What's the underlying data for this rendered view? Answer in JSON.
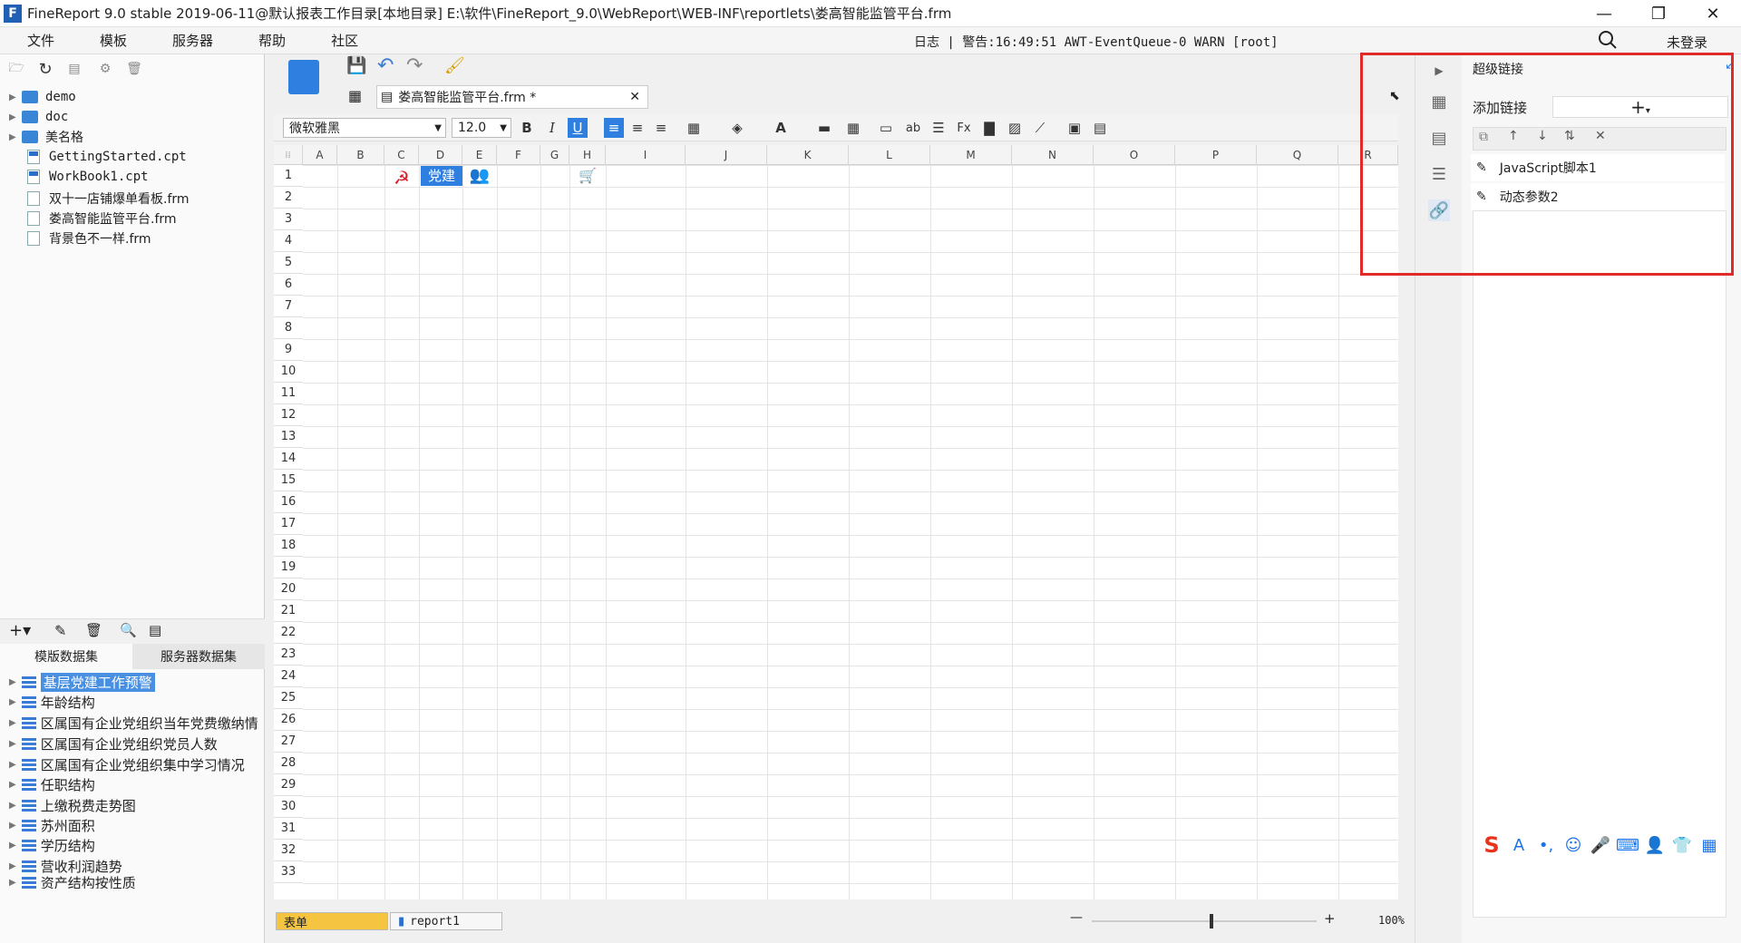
{
  "window": {
    "title": "FineReport 9.0 stable 2019-06-11@默认报表工作目录[本地目录]    E:\\软件\\FineReport_9.0\\WebReport\\WEB-INF\\reportlets\\娄高智能监管平台.frm",
    "logo": "F"
  },
  "menu": [
    "文件",
    "模板",
    "服务器",
    "帮助",
    "社区"
  ],
  "status": "日志 | 警告:16:49:51 AWT-EventQueue-0 WARN [root]",
  "login": "未登录",
  "file_tree": [
    {
      "label": "demo",
      "type": "folder"
    },
    {
      "label": "doc",
      "type": "folder"
    },
    {
      "label": "美名格",
      "type": "folder"
    },
    {
      "label": "GettingStarted.cpt",
      "type": "cpt"
    },
    {
      "label": "WorkBook1.cpt",
      "type": "cpt"
    },
    {
      "label": "双十一店铺爆单看板.frm",
      "type": "frm"
    },
    {
      "label": "娄高智能监管平台.frm",
      "type": "frm"
    },
    {
      "label": "背景色不一样.frm",
      "type": "frm"
    }
  ],
  "dataset_tabs": [
    "模版数据集",
    "服务器数据集"
  ],
  "datasets": [
    "基层党建工作预警",
    "年龄结构",
    "区属国有企业党组织当年党费缴纳情",
    "区属国有企业党组织党员人数",
    "区属国有企业党组织集中学习情况",
    "任职结构",
    "上缴税费走势图",
    "苏州面积",
    "学历结构",
    "营收利润趋势",
    "资产结构按性质"
  ],
  "doc_tab": "娄高智能监管平台.frm *",
  "format": {
    "font": "微软雅黑",
    "size": "12.0"
  },
  "columns": [
    "A",
    "B",
    "C",
    "D",
    "E",
    "F",
    "G",
    "H",
    "I",
    "J",
    "K",
    "L",
    "M",
    "N",
    "O",
    "P",
    "Q",
    "R"
  ],
  "rows": [
    "1",
    "2",
    "3",
    "4",
    "5",
    "6",
    "7",
    "8",
    "9",
    "10",
    "11",
    "12",
    "13",
    "14",
    "15",
    "16",
    "17",
    "18",
    "19",
    "20",
    "21",
    "22",
    "23",
    "24",
    "25",
    "26",
    "27",
    "28",
    "29",
    "30",
    "31",
    "32",
    "33"
  ],
  "cell_d1": "党建",
  "sheet_tabs": [
    "表单",
    "report1"
  ],
  "zoom": "100%",
  "hyperlink": {
    "title": "超级链接",
    "add_label": "添加链接",
    "items": [
      "JavaScript脚本1",
      "动态参数2"
    ]
  },
  "colors": {
    "accent": "#2f7fe0",
    "highlight": "#e12a2a"
  }
}
